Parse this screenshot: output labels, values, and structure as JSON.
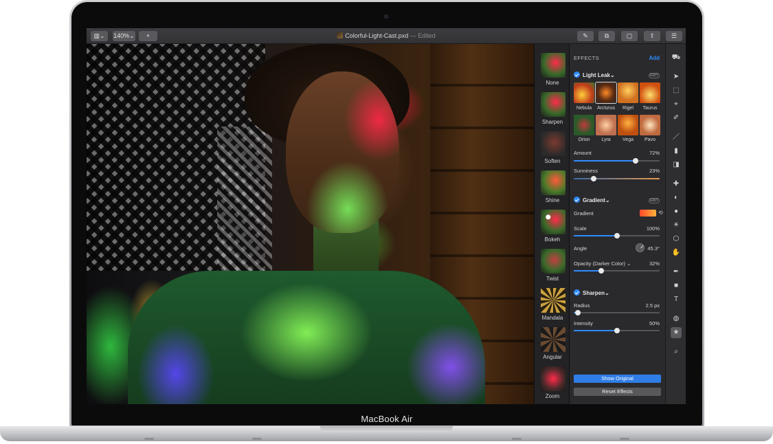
{
  "device": {
    "label": "MacBook Air"
  },
  "toolbar": {
    "sidebar_toggle": "▥",
    "sidebar_chevron": "⌄",
    "zoom": "140%",
    "zoom_chevron": "⌄",
    "add": "+",
    "right_buttons": [
      "✎",
      "⧉",
      "▢",
      "⇪",
      "☰"
    ]
  },
  "document": {
    "title": "Colorful-Light-Cast.pxd",
    "separator": "—",
    "status": "Edited"
  },
  "effects_browser": [
    "None",
    "Sharpen",
    "Soften",
    "Shine",
    "Bokeh",
    "Twist",
    "Mandala",
    "Angular",
    "Zoom"
  ],
  "inspector": {
    "header": "EFFECTS",
    "add_label": "Add",
    "edit_label": "EDIT",
    "light_leak": {
      "title": "Light Leak",
      "chevron": "⌄",
      "presets": [
        "Nebula",
        "Arcturus",
        "Rigel",
        "Taurus",
        "Orion",
        "Lyra",
        "Vega",
        "Pavo"
      ],
      "selected_preset": "Arcturus",
      "amount": {
        "label": "Amount",
        "value": "72%",
        "fraction": 0.72
      },
      "sunniness": {
        "label": "Sunniness",
        "value": "23%",
        "fraction": 0.23
      }
    },
    "gradient": {
      "title": "Gradient",
      "chevron": "⌄",
      "gradient_label": "Gradient",
      "cycle_icon": "⟲",
      "scale": {
        "label": "Scale",
        "value": "100%",
        "fraction": 0.5
      },
      "angle": {
        "label": "Angle",
        "value": "45.3°"
      },
      "opacity": {
        "label": "Opacity (Darker Color)",
        "chevron": "⌄",
        "value": "32%",
        "fraction": 0.32
      }
    },
    "sharpen": {
      "title": "Sharpen",
      "chevron": "⌄",
      "radius": {
        "label": "Radius",
        "value": "2.5 px",
        "fraction": 0.05
      },
      "intensity": {
        "label": "Intensity",
        "value": "50%",
        "fraction": 0.5
      }
    },
    "show_original": "Show Original",
    "reset_effects": "Reset Effects"
  },
  "tools": [
    "⛟",
    "➤",
    "⬚",
    "⌖",
    "✐",
    "／",
    "▮",
    "◨",
    "✚",
    "◐",
    "●",
    "☀",
    "⬡",
    "✋",
    "✒",
    "■",
    "T",
    "◍",
    "★",
    "⌕"
  ],
  "colors": {
    "accent": "#2f8cff",
    "show_original_bg": "#2f7de6"
  }
}
